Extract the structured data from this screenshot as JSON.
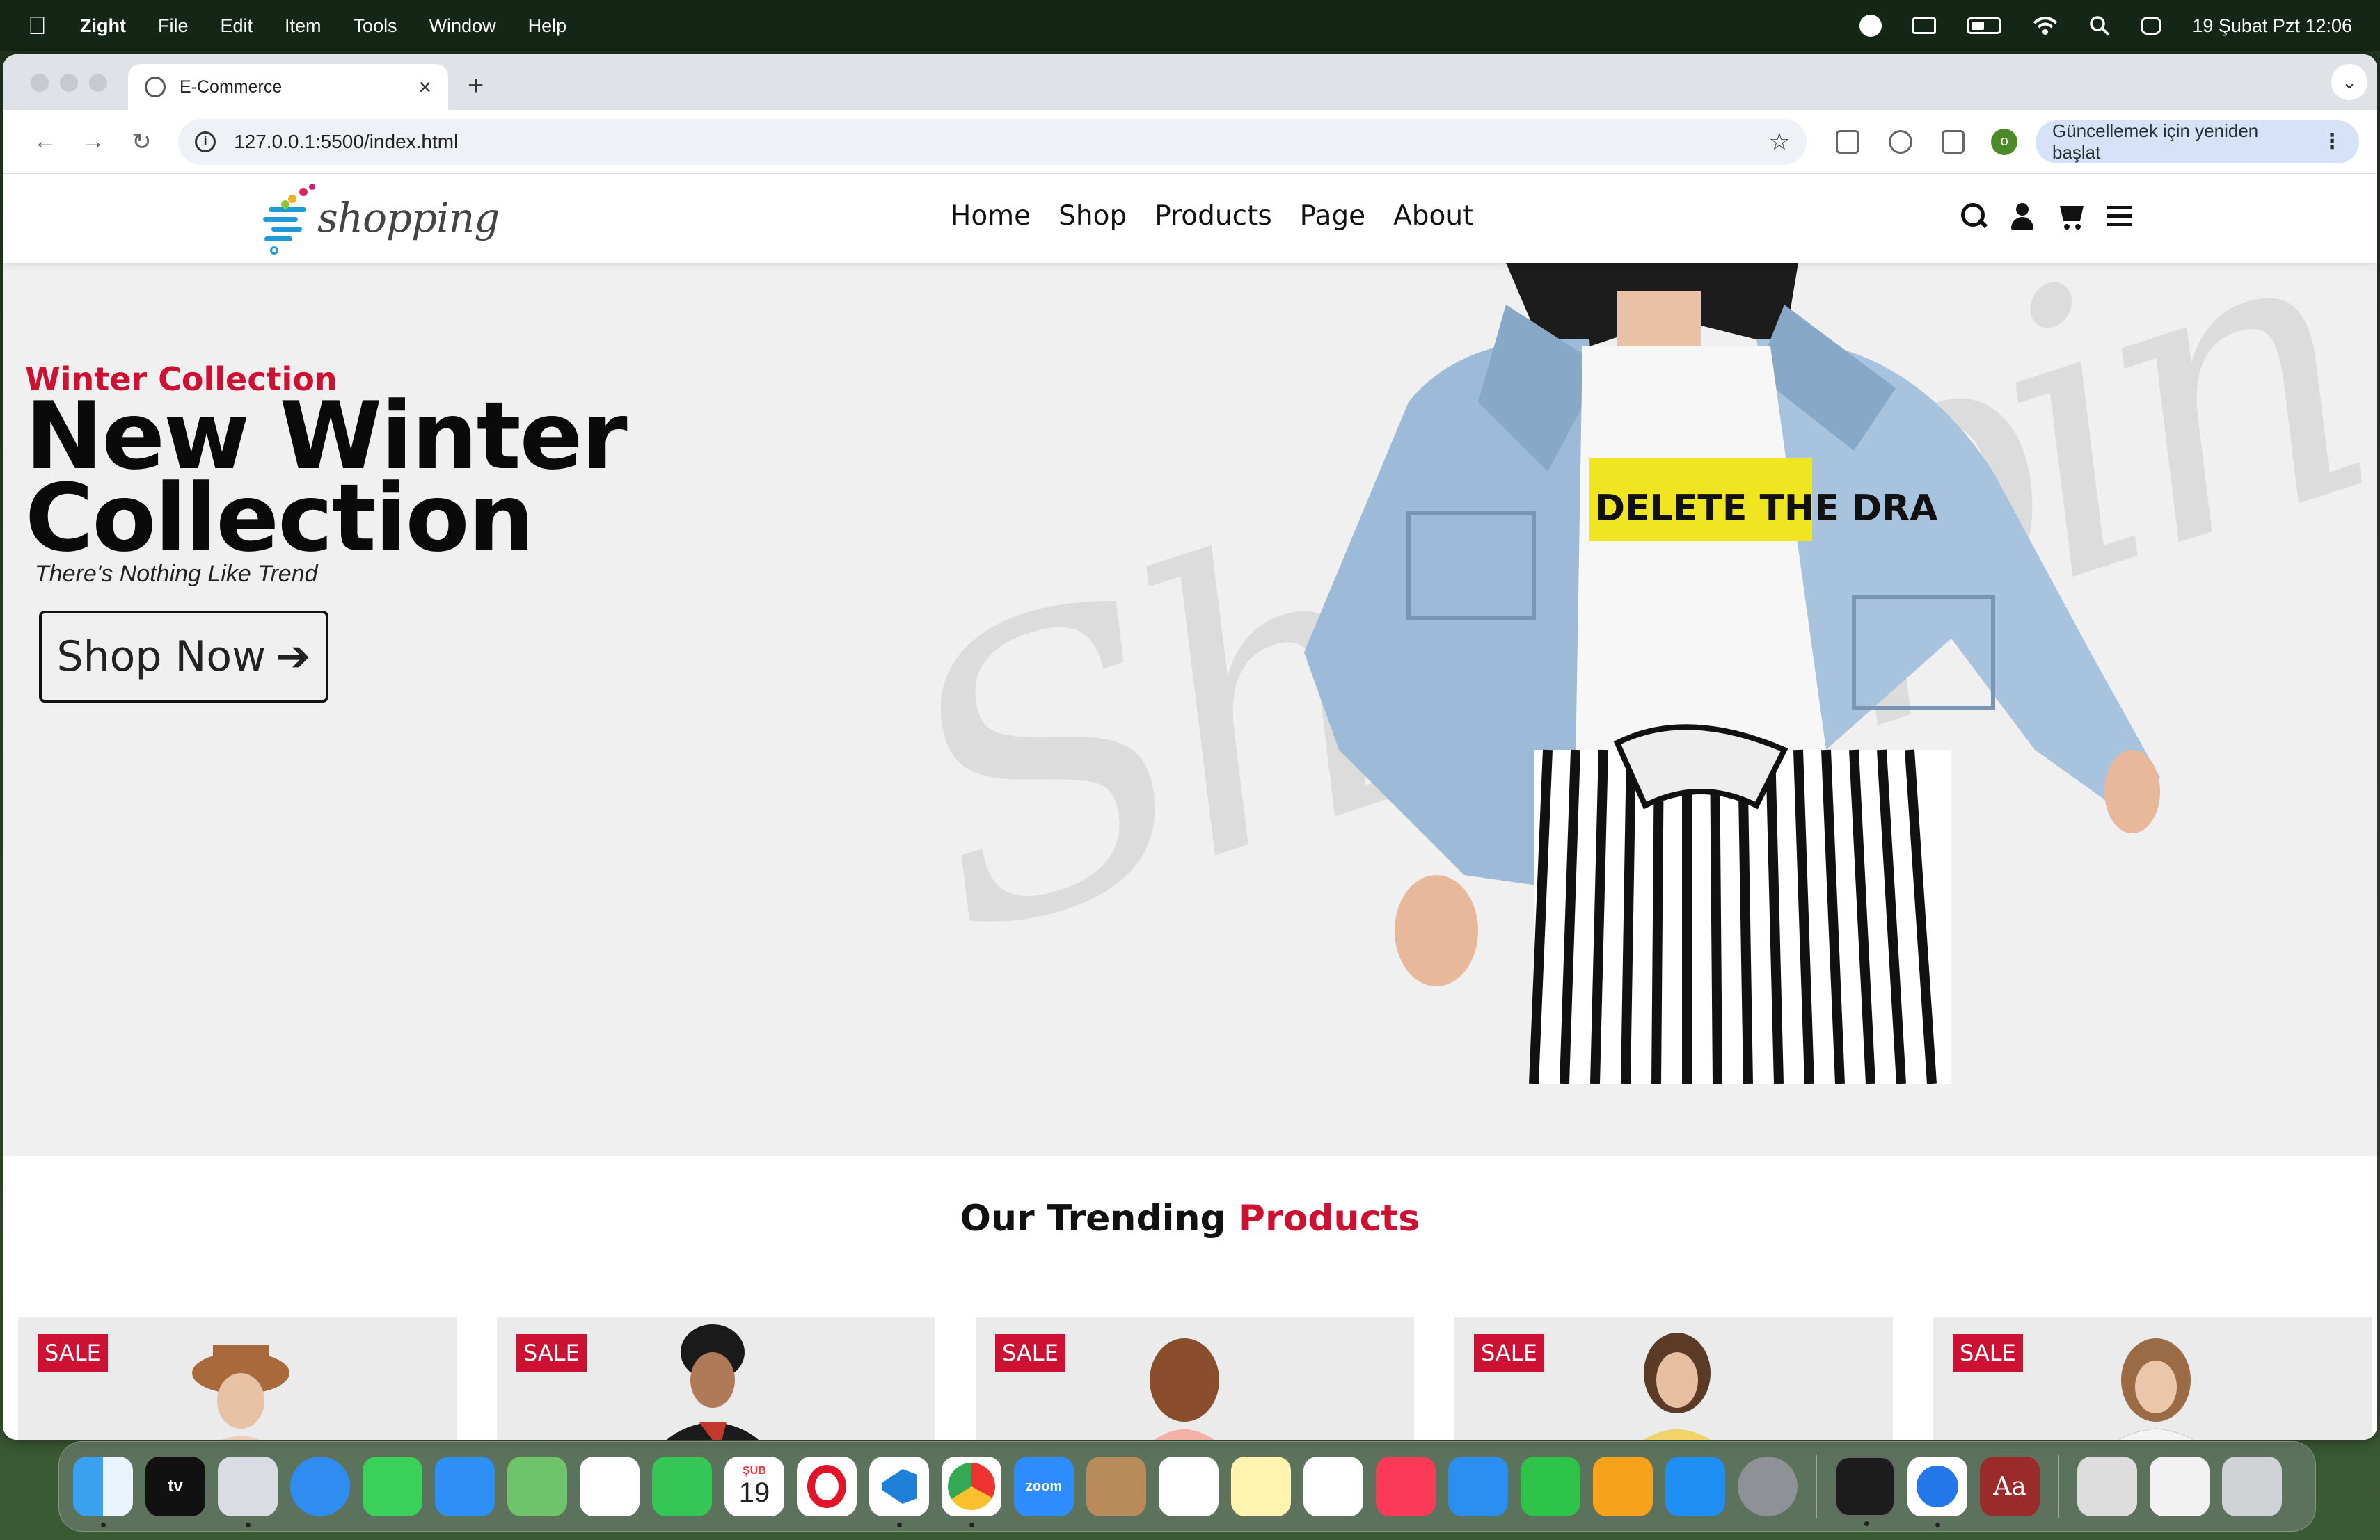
{
  "menubar": {
    "app_name": "Zight",
    "items": [
      "File",
      "Edit",
      "Item",
      "Tools",
      "Window",
      "Help"
    ],
    "datetime": "19 Şubat Pzt  12:06"
  },
  "browser": {
    "tab_title": "E-Commerce",
    "new_tab": "+",
    "url": "127.0.0.1:5500/index.html",
    "profile_initial": "o",
    "update_button": "Güncellemek için yeniden başlat"
  },
  "site": {
    "logo_text": "shopping",
    "nav": [
      "Home",
      "Shop",
      "Products",
      "Page",
      "About"
    ],
    "hero": {
      "subtitle": "Winter Collection",
      "title_line1": "New Winter",
      "title_line2": "Collection",
      "tagline": "There's Nothing Like Trend",
      "button": "Shop Now",
      "watermark": "Shopping",
      "shirt_text": "DELETE THE DRA"
    },
    "trending": {
      "title_plain": "Our Trending",
      "title_accent": "Products"
    },
    "cards": [
      {
        "badge": "SALE"
      },
      {
        "badge": "SALE"
      },
      {
        "badge": "SALE"
      },
      {
        "badge": "SALE"
      },
      {
        "badge": "SALE"
      }
    ]
  },
  "dock": {
    "apps": [
      "finder-icon",
      "apple-tv-icon",
      "launchpad-icon",
      "safari-icon",
      "messages-icon",
      "mail-icon",
      "maps-icon",
      "photos-icon",
      "facetime-icon",
      "calendar-icon",
      "opera-icon",
      "vscode-icon",
      "chrome-icon",
      "zoom-icon",
      "contacts-icon",
      "reminders-icon",
      "notes-icon",
      "freeform-icon",
      "music-icon",
      "keynote-icon",
      "numbers-icon",
      "pages-icon",
      "app-store-icon",
      "system-settings-icon",
      "terminal-icon",
      "zight-icon",
      "dictionary-icon"
    ],
    "calendar_month": "ŞUB",
    "calendar_day": "19",
    "zoom_label": "zoom",
    "tv_label": "tv",
    "dictionary_label": "Aa"
  },
  "colors": {
    "accent": "#cc1133",
    "hero_bg": "#f0f0f0"
  }
}
